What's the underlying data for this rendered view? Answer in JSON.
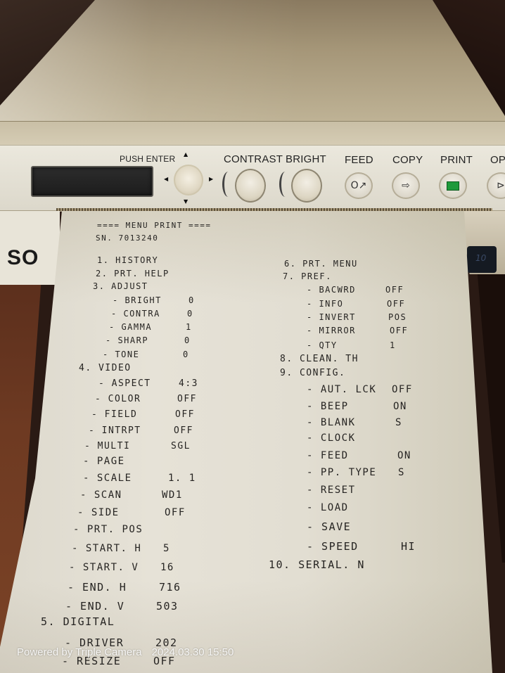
{
  "device": {
    "brand_partial": "SO",
    "badge_partial": "10",
    "panel": {
      "push_enter_label": "PUSH ENTER",
      "buttons": [
        {
          "id": "contrast",
          "label": "CONTRAST",
          "icon": "knob"
        },
        {
          "id": "bright",
          "label": "BRIGHT",
          "icon": "knob"
        },
        {
          "id": "feed",
          "label": "FEED",
          "icon": "feed-icon"
        },
        {
          "id": "copy",
          "label": "COPY",
          "icon": "copy-icon"
        },
        {
          "id": "print",
          "label": "PRINT",
          "icon": "print-icon"
        },
        {
          "id": "open",
          "label": "OP",
          "icon": "open-icon"
        }
      ],
      "accent_print_color": "#1f9a3b"
    }
  },
  "printout": {
    "header": "==== MENU PRINT ====",
    "serial": "SN. 7013240",
    "left_column": [
      {
        "type": "section",
        "text": "1. HISTORY"
      },
      {
        "type": "section",
        "text": "2. PRT. HELP"
      },
      {
        "type": "section",
        "text": "3. ADJUST"
      },
      {
        "type": "item",
        "name": "- BRIGHT",
        "value": "0"
      },
      {
        "type": "item",
        "name": "- CONTRA",
        "value": "0"
      },
      {
        "type": "item",
        "name": "- GAMMA",
        "value": "1"
      },
      {
        "type": "item",
        "name": "- SHARP",
        "value": "0"
      },
      {
        "type": "item",
        "name": "- TONE",
        "value": "0"
      },
      {
        "type": "section",
        "text": "4. VIDEO"
      },
      {
        "type": "item",
        "name": "- ASPECT",
        "value": "4:3"
      },
      {
        "type": "item",
        "name": "- COLOR",
        "value": "OFF"
      },
      {
        "type": "item",
        "name": "- FIELD",
        "value": "OFF"
      },
      {
        "type": "item",
        "name": "- INTRPT",
        "value": "OFF"
      },
      {
        "type": "item",
        "name": "- MULTI",
        "value": "SGL"
      },
      {
        "type": "item",
        "name": "- PAGE",
        "value": ""
      },
      {
        "type": "item",
        "name": "- SCALE",
        "value": "1. 1"
      },
      {
        "type": "item",
        "name": "- SCAN",
        "value": "WD1"
      },
      {
        "type": "item",
        "name": "- SIDE",
        "value": "OFF"
      },
      {
        "type": "item",
        "name": "- PRT. POS",
        "value": ""
      },
      {
        "type": "item",
        "name": "- START. H",
        "value": "5"
      },
      {
        "type": "item",
        "name": "- START. V",
        "value": "16"
      },
      {
        "type": "item",
        "name": "- END. H",
        "value": "716"
      },
      {
        "type": "item",
        "name": "- END. V",
        "value": "503"
      },
      {
        "type": "section",
        "text": "5. DIGITAL"
      },
      {
        "type": "item",
        "name": "- DRIVER",
        "value": "202"
      },
      {
        "type": "item",
        "name": "- RESIZE",
        "value": "OFF"
      }
    ],
    "right_column": [
      {
        "type": "section",
        "text": "6. PRT. MENU"
      },
      {
        "type": "section",
        "text": "7. PREF."
      },
      {
        "type": "item",
        "name": "- BACWRD",
        "value": "OFF"
      },
      {
        "type": "item",
        "name": "- INFO",
        "value": "OFF"
      },
      {
        "type": "item",
        "name": "- INVERT",
        "value": "POS"
      },
      {
        "type": "item",
        "name": "- MIRROR",
        "value": "OFF"
      },
      {
        "type": "item",
        "name": "- QTY",
        "value": "1"
      },
      {
        "type": "section",
        "text": "8. CLEAN. TH"
      },
      {
        "type": "section",
        "text": "9. CONFIG."
      },
      {
        "type": "item",
        "name": "- AUT. LCK",
        "value": "OFF"
      },
      {
        "type": "item",
        "name": "- BEEP",
        "value": "ON"
      },
      {
        "type": "item",
        "name": "- BLANK",
        "value": "S"
      },
      {
        "type": "item",
        "name": "- CLOCK",
        "value": ""
      },
      {
        "type": "item",
        "name": "- FEED",
        "value": "ON"
      },
      {
        "type": "item",
        "name": "- PP. TYPE",
        "value": "S"
      },
      {
        "type": "item",
        "name": "- RESET",
        "value": ""
      },
      {
        "type": "item",
        "name": "- LOAD",
        "value": ""
      },
      {
        "type": "item",
        "name": "- SAVE",
        "value": ""
      },
      {
        "type": "item",
        "name": "- SPEED",
        "value": "HI"
      },
      {
        "type": "section",
        "text": "10. SERIAL. N"
      }
    ]
  },
  "watermark": {
    "text": "Powered by Triple Camera",
    "timestamp": "2024.03.30 15:50"
  }
}
